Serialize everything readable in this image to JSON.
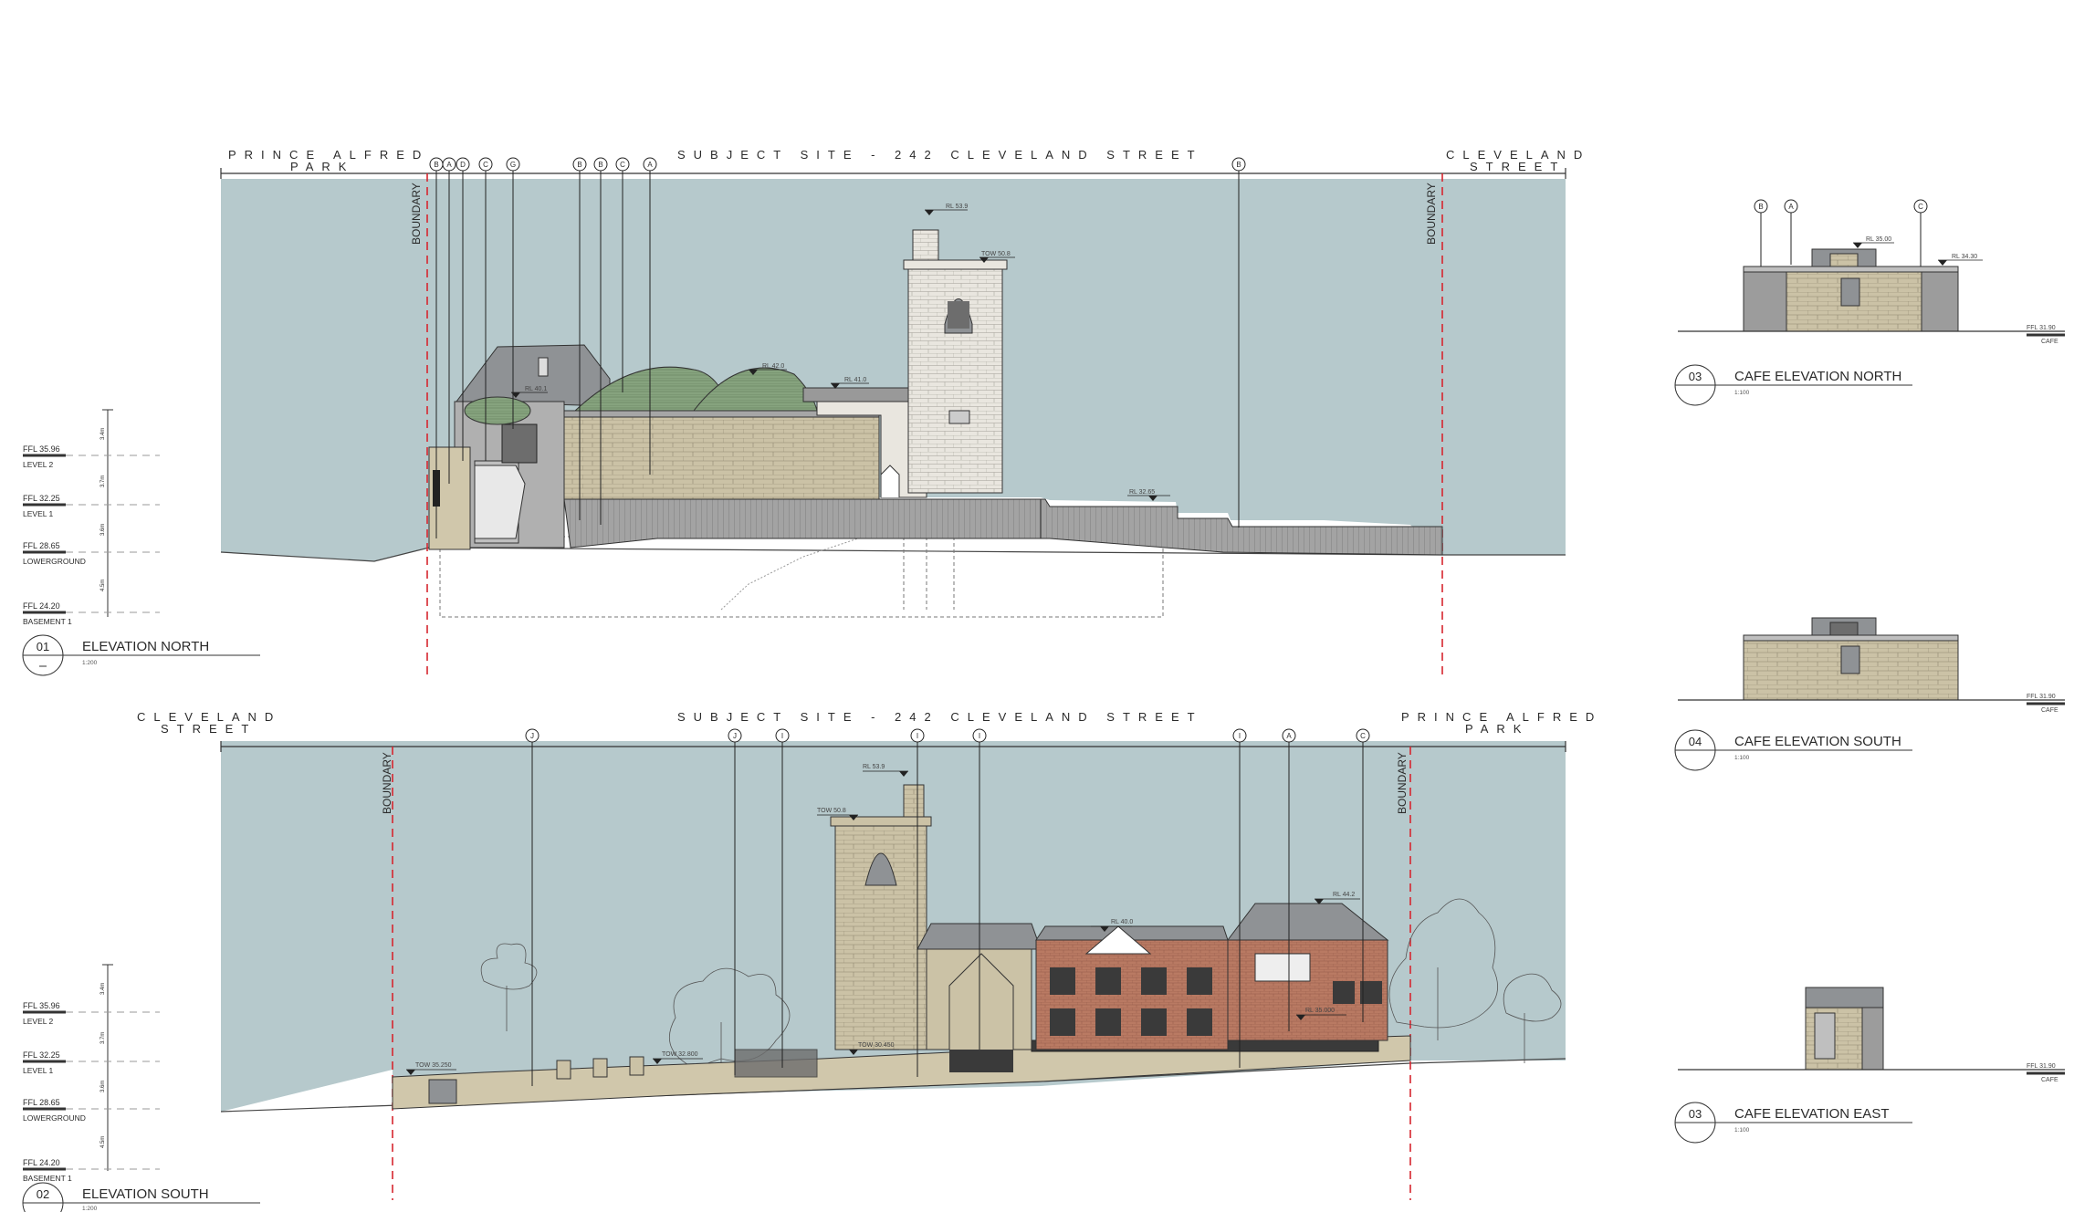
{
  "elevation_north": {
    "left_label_1": "PRINCE ALFRED",
    "left_label_2": "PARK",
    "center_label": "SUBJECT SITE - 242 CLEVELAND STREET",
    "right_label_1": "CLEVELAND",
    "right_label_2": "STREET",
    "boundary": "BOUNDARY",
    "number": "01",
    "title": "ELEVATION NORTH",
    "scale": "1:200",
    "callouts": [
      "B",
      "A",
      "D",
      "C",
      "G",
      "B",
      "B",
      "C",
      "A",
      "B"
    ],
    "rl_tags": [
      "RL 53.9",
      "TOW 50.8",
      "RL 42.0",
      "RL 41.0",
      "RL 40.1",
      "RL 32.65"
    ]
  },
  "elevation_south": {
    "left_label_1": "CLEVELAND",
    "left_label_2": "STREET",
    "center_label": "SUBJECT SITE - 242 CLEVELAND STREET",
    "right_label_1": "PRINCE ALFRED",
    "right_label_2": "PARK",
    "boundary": "BOUNDARY",
    "number": "02",
    "title": "ELEVATION SOUTH",
    "scale": "1:200",
    "callouts": [
      "J",
      "J",
      "I",
      "I",
      "I",
      "I",
      "A",
      "C"
    ],
    "rl_tags": [
      "RL 53.9",
      "TOW 50.8",
      "RL 40.0",
      "RL 44.2",
      "TOW 35.250",
      "TOW 32.800",
      "TOW 30.450",
      "RL 35.000"
    ]
  },
  "levels": [
    {
      "ffl": "FFL 35.96",
      "name": "LEVEL 2"
    },
    {
      "ffl": "FFL 32.25",
      "name": "LEVEL 1"
    },
    {
      "ffl": "FFL 28.65",
      "name": "LOWERGROUND"
    },
    {
      "ffl": "FFL 24.20",
      "name": "BASEMENT 1"
    }
  ],
  "level_dims": [
    "3.4m",
    "3.7m",
    "3.6m",
    "4.5m"
  ],
  "cafe_north": {
    "number": "03",
    "title": "CAFE ELEVATION NORTH",
    "scale": "1:100",
    "callouts": [
      "B",
      "A",
      "C"
    ],
    "rl_tags": [
      "RL 35.00",
      "RL 34.30"
    ],
    "ffl": "FFL 31.90",
    "ffl_name": "CAFE"
  },
  "cafe_south": {
    "number": "04",
    "title": "CAFE ELEVATION SOUTH",
    "scale": "1:100",
    "ffl": "FFL 31.90",
    "ffl_name": "CAFE"
  },
  "cafe_east": {
    "number": "03",
    "title": "CAFE ELEVATION EAST",
    "scale": "1:100",
    "ffl": "FFL 31.90",
    "ffl_name": "CAFE"
  },
  "colors": {
    "sky": "#b6c9cc",
    "sandstone": "#cbc2a6",
    "brick": "#b97a63",
    "roof_green": "#86a37e",
    "roof_grey": "#8f9295",
    "concrete": "#9c9c9c",
    "boundary_red": "#d6262f",
    "line": "#333333"
  }
}
